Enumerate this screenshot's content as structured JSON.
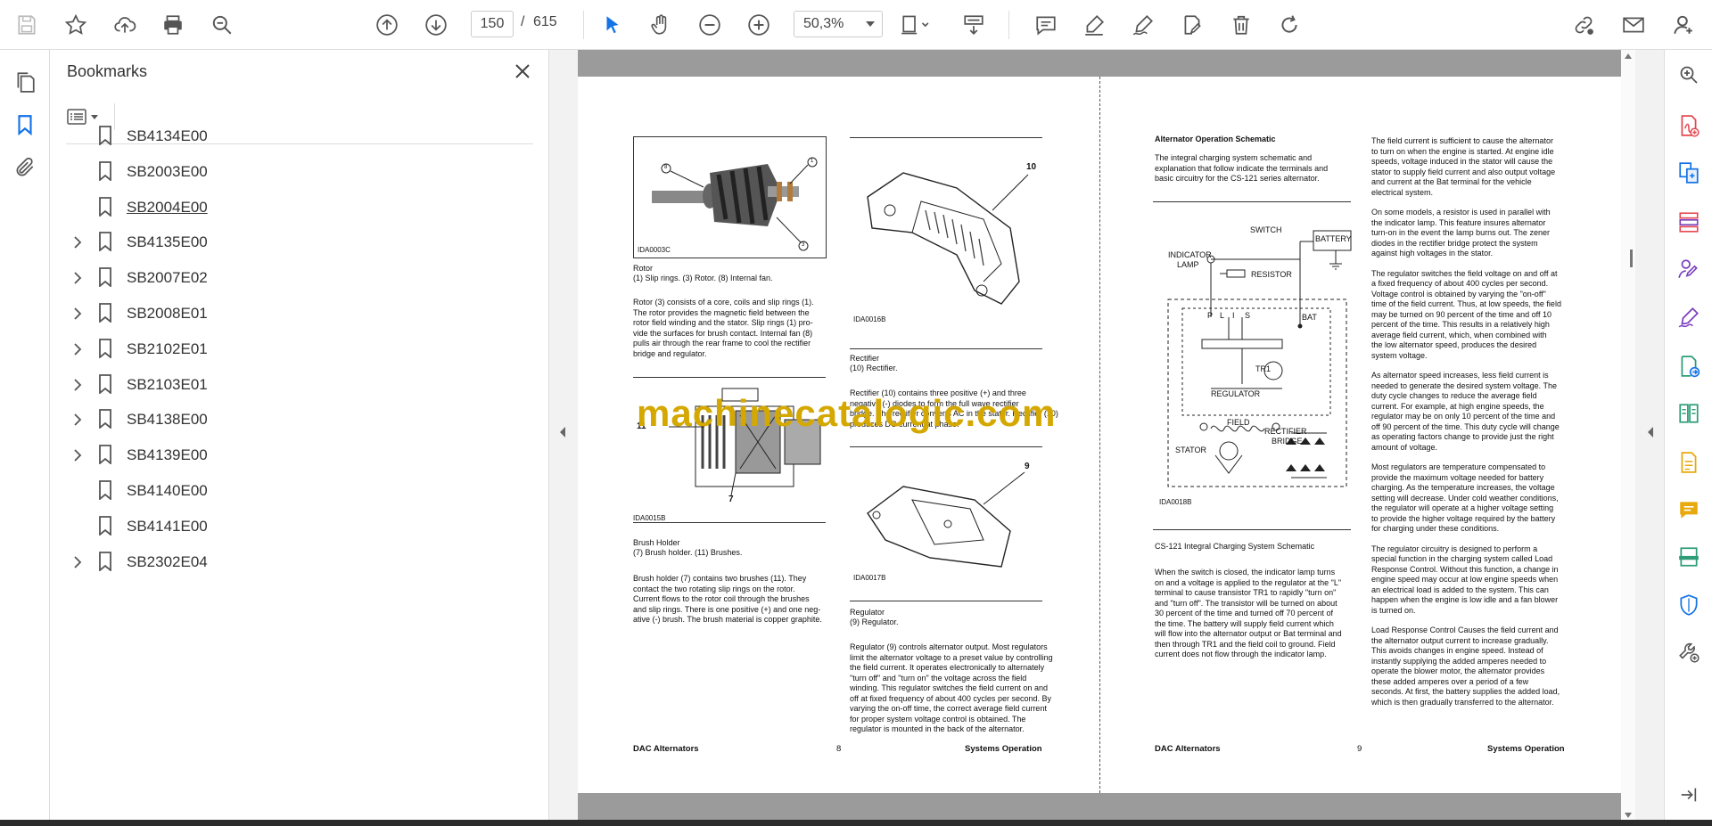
{
  "toolbar": {
    "page_current": "150",
    "page_separator": "/",
    "page_total": "615",
    "zoom": "50,3%"
  },
  "bookmarks_panel": {
    "title": "Bookmarks",
    "items": [
      {
        "label": "SB4134E00",
        "expandable": false
      },
      {
        "label": "SB2003E00",
        "expandable": false
      },
      {
        "label": "SB2004E00",
        "expandable": false,
        "selected": true
      },
      {
        "label": "SB4135E00",
        "expandable": true
      },
      {
        "label": "SB2007E02",
        "expandable": true
      },
      {
        "label": "SB2008E01",
        "expandable": true
      },
      {
        "label": "SB2102E01",
        "expandable": true
      },
      {
        "label": "SB2103E01",
        "expandable": true
      },
      {
        "label": "SB4138E00",
        "expandable": true
      },
      {
        "label": "SB4139E00",
        "expandable": true
      },
      {
        "label": "SB4140E00",
        "expandable": false
      },
      {
        "label": "SB4141E00",
        "expandable": false
      },
      {
        "label": "SB2302E04",
        "expandable": true
      }
    ]
  },
  "colors": {
    "accent": "#1473e6",
    "watermark": "#d4a800",
    "tool_red": "#e34850",
    "tool_purple": "#7b3fbf",
    "tool_green": "#2d9d78",
    "tool_yellow": "#e8a90c"
  },
  "document": {
    "watermark": "machinecatalogic.com",
    "left_page": {
      "fig_rotor_tag": "IDA0003C",
      "fig_rotor_caption": "Rotor",
      "fig_rotor_legend": "(1) Slip rings. (3) Rotor. (8) Internal fan.",
      "rotor_text": [
        "Rotor (3) consists of a core, coils and slip rings (1).",
        "The rotor provides the magnetic field between the",
        "rotor field winding and the stator. Slip rings (1) pro-",
        "vide the surfaces for brush contact. Internal fan (8)",
        "pulls air through the rear frame to cool the rectifier",
        "bridge and regulator."
      ],
      "fig_brush_tag": "IDA0015B",
      "fig_brush_caption": "Brush Holder",
      "fig_brush_legend": "(7) Brush holder. (11) Brushes.",
      "brush_text": [
        "Brush holder (7) contains two brushes (11). They",
        "contact the two rotating slip rings on the rotor.",
        "Current flows to the rotor coil through the brushes",
        "and slip rings. There is one positive (+) and one neg-",
        "ative (-) brush. The brush material is copper graphite."
      ],
      "fig_rect_tag": "IDA0016B",
      "fig_rect_caption": "Rectifier",
      "fig_rect_legend": "(10) Rectifier.",
      "rect_text": [
        "Rectifier (10) contains three positive (+) and three",
        "negative (-) diodes to form the full wave rectifier",
        "bridge. The rectifier converts AC in the stator. Rectifier (10)",
        "produces DC current at phase."
      ],
      "fig_reg_tag": "IDA0017B",
      "fig_reg_caption": "Regulator",
      "fig_reg_legend": "(9) Regulator.",
      "reg_text": [
        "Regulator (9) controls alternator output. Most regulators",
        "limit the alternator voltage to a preset value by controlling",
        "the field current. It operates electronically to alternately",
        "\"turn off\" and \"turn on\" the voltage across the field",
        "winding. This regulator switches the field current on and",
        "off at fixed frequency of about 400 cycles per second. By",
        "varying the on-off time, the correct average field current",
        "for proper system voltage control is obtained. The",
        "regulator is mounted in the back of the alternator."
      ],
      "num_8": "8",
      "num_1": "1",
      "num_3": "3",
      "num_10": "10",
      "num_11": "11",
      "num_7": "7",
      "num_9": "9",
      "footer_left": "DAC Alternators",
      "footer_page": "8",
      "footer_right": "Systems Operation"
    },
    "right_page": {
      "heading": "Alternator Operation Schematic",
      "intro": [
        "The integral charging system schematic and",
        "explanation that follow indicate the terminals and",
        "basic circuitry for the CS-121 series alternator."
      ],
      "schematic_labels": {
        "switch": "SWITCH",
        "battery": "BATTERY",
        "indicator": "INDICATOR",
        "lamp": "LAMP",
        "resistor": "RESISTOR",
        "bat": "BAT",
        "p": "P",
        "l": "L",
        "i": "I",
        "s": "S",
        "tr1": "TR1",
        "regulator": "REGULATOR",
        "field": "FIELD",
        "rectifier": "RECTIFIER",
        "bridge": "BRIDGE",
        "stator": "STATOR",
        "tag": "IDA0018B"
      },
      "schematic_caption": "CS-121 Integral Charging System Schematic",
      "left_col_text": [
        "When the switch is closed, the indicator lamp turns",
        "on and a voltage is applied to the regulator at the \"L\"",
        "terminal to cause transistor TR1 to rapidly \"turn on\"",
        "and \"turn off\". The transistor will be turned on about",
        "30 percent of the time and turned off 70 percent of",
        "the time. The battery will supply field current which",
        "will flow into the alternator output or Bat terminal and",
        "then through TR1 and the field coil to ground. Field",
        "current does not flow through the indicator lamp."
      ],
      "right_col_paras": [
        [
          "The field current is sufficient to cause the alternator",
          "to turn on when the engine is started. At engine idle",
          "speeds, voltage induced in the stator will cause the",
          "stator to supply field current and also output voltage",
          "and current at the Bat terminal for the vehicle",
          "electrical system."
        ],
        [
          "On some models, a resistor is used in parallel with",
          "the indicator lamp. This feature insures alternator",
          "turn-on in the event the lamp burns out. The zener",
          "diodes in the rectifier bridge protect the system",
          "against high voltages in the stator."
        ],
        [
          "The regulator switches the field voltage on and off at",
          "a fixed frequency of about 400 cycles per second.",
          "Voltage control is obtained by varying the \"on-off\"",
          "time of the field current. Thus, at low speeds, the field",
          "may be turned on 90 percent of the time and off 10",
          "percent of the time. This results in a relatively high",
          "average field current, which, when combined with",
          "the low alternator speed, produces the desired",
          "system voltage."
        ],
        [
          "As alternator speed increases, less field current is",
          "needed to generate the desired system voltage. The",
          "duty cycle changes to reduce the average field",
          "current. For example, at high engine speeds, the",
          "regulator may be on only 10 percent of the time and",
          "off 90 percent of the time. This duty cycle will change",
          "as operating factors change to provide just the right",
          "amount of voltage."
        ],
        [
          "Most regulators are temperature compensated to",
          "provide the maximum voltage needed for battery",
          "charging. As the temperature increases, the voltage",
          "setting will decrease. Under cold weather conditions,",
          "the regulator will operate at a higher voltage setting",
          "to provide the higher voltage required by the battery",
          "for charging under these conditions."
        ],
        [
          "The regulator circuitry is designed to perform a",
          "special function in the charging system called Load",
          "Response Control. Without this function, a change in",
          "engine speed may occur at low engine speeds when",
          "an electrical load is added to the system. This can",
          "happen when the engine is low idle and a fan blower",
          "is turned on."
        ],
        [
          "Load Response Control Causes the field current and",
          "the alternator output current to increase gradually.",
          "This avoids changes in engine speed. Instead of",
          "instantly supplying the added amperes needed to",
          "operate the blower motor, the alternator provides",
          "these added amperes over a period of a few",
          "seconds. At first, the battery supplies the added load,",
          "which is then gradually transferred to the alternator."
        ]
      ],
      "footer_left": "DAC Alternators",
      "footer_page": "9",
      "footer_right": "Systems Operation"
    }
  }
}
